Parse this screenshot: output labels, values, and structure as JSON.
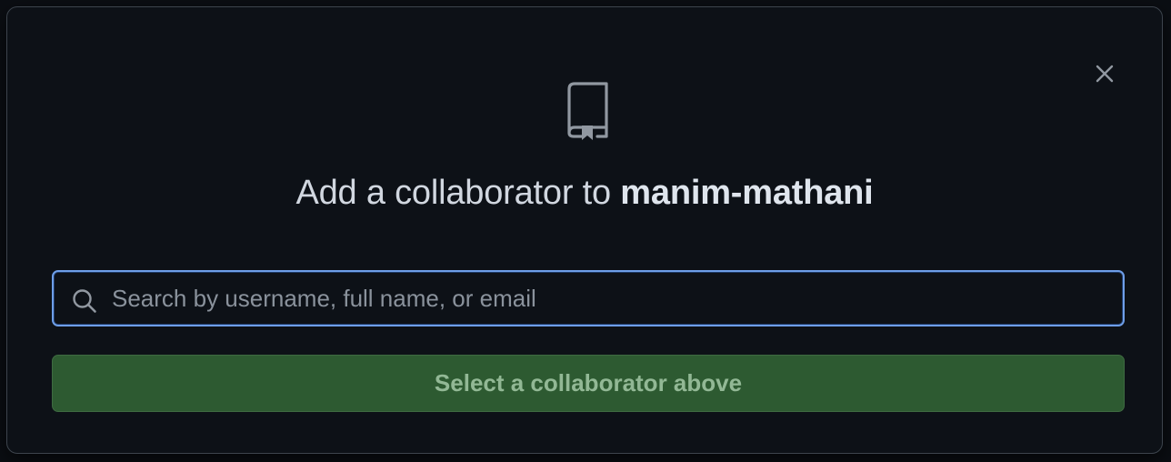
{
  "dialog": {
    "title_prefix": "Add a collaborator to ",
    "repo_name": "manim-mathani",
    "header_icon": "repo-icon",
    "close_icon": "close-icon"
  },
  "search": {
    "icon": "search-icon",
    "value": "",
    "placeholder": "Search by username, full name, or email"
  },
  "submit": {
    "label": "Select a collaborator above",
    "state": "disabled"
  },
  "colors": {
    "background": "#0d1117",
    "border": "#3d444d",
    "focus_ring": "#6e9ee8",
    "button_bg": "#2d5a31",
    "button_text": "#92b895",
    "text": "#d1d7e0",
    "muted": "#8a929c"
  }
}
